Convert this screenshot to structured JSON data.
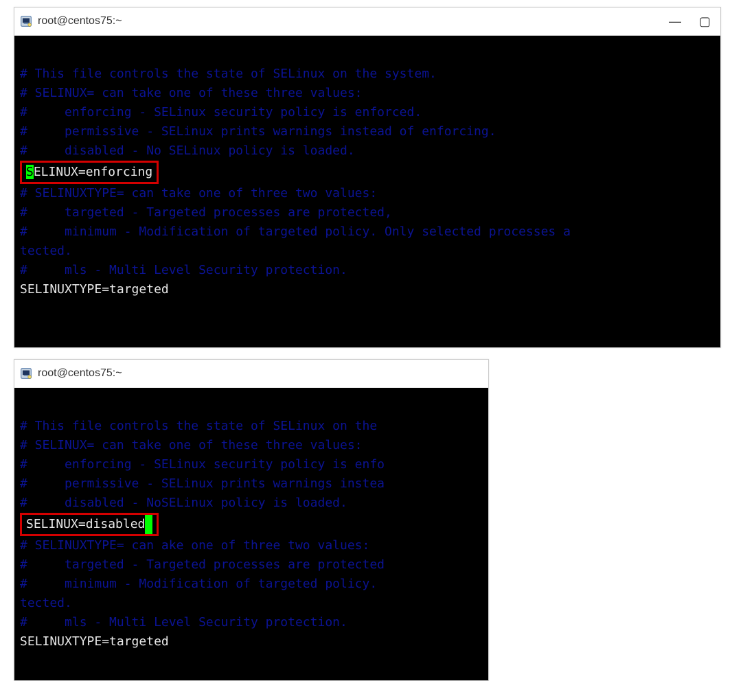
{
  "window1": {
    "title": "root@centos75:~",
    "term": {
      "l1": "# This file controls the state of SELinux on the system.",
      "l2": "# SELINUX= can take one of these three values:",
      "l3": "#     enforcing - SELinux security policy is enforced.",
      "l4": "#     permissive - SELinux prints warnings instead of enforcing.",
      "l5prefix": "#     disabled - No",
      "l5suffix": " SELinux policy is loaded.",
      "selinux_first_char": "S",
      "selinux_rest": "ELINUX=enforcing",
      "l7": "# SELINUXTYPE= can take one of three two values:",
      "l8": "#     targeted - Targeted processes are protected,",
      "l9": "#     minimum - Modification of targeted policy. Only selected processes a",
      "l9b": "tected.",
      "l10": "#     mls - Multi Level Security protection.",
      "l11": "SELINUXTYPE=targeted"
    },
    "controls": {
      "min": "—",
      "max": "▢"
    }
  },
  "window2": {
    "title": "root@centos75:~",
    "term": {
      "l1": "# This file controls the state of SELinux on the ",
      "l2": "# SELINUX= can take one of these three values:",
      "l3": "#     enforcing - SELinux security policy is enfo",
      "l4": "#     permissive - SELinux prints warnings instea",
      "l5prefix": "#     disabled - No",
      "l5suffix": "SELinux policy is loaded.",
      "selinux_line": "SELINUX=disabled",
      "l7pre": "# SELINUXTYPE= can ",
      "l7post": "ake one of three two values:",
      "l8": "#     targeted - Targeted processes are protected",
      "l9": "#     minimum - Modification of targeted policy. ",
      "l9b": "tected.",
      "l10": "#     mls - Multi Level Security protection.",
      "l11": "SELINUXTYPE=targeted"
    }
  }
}
